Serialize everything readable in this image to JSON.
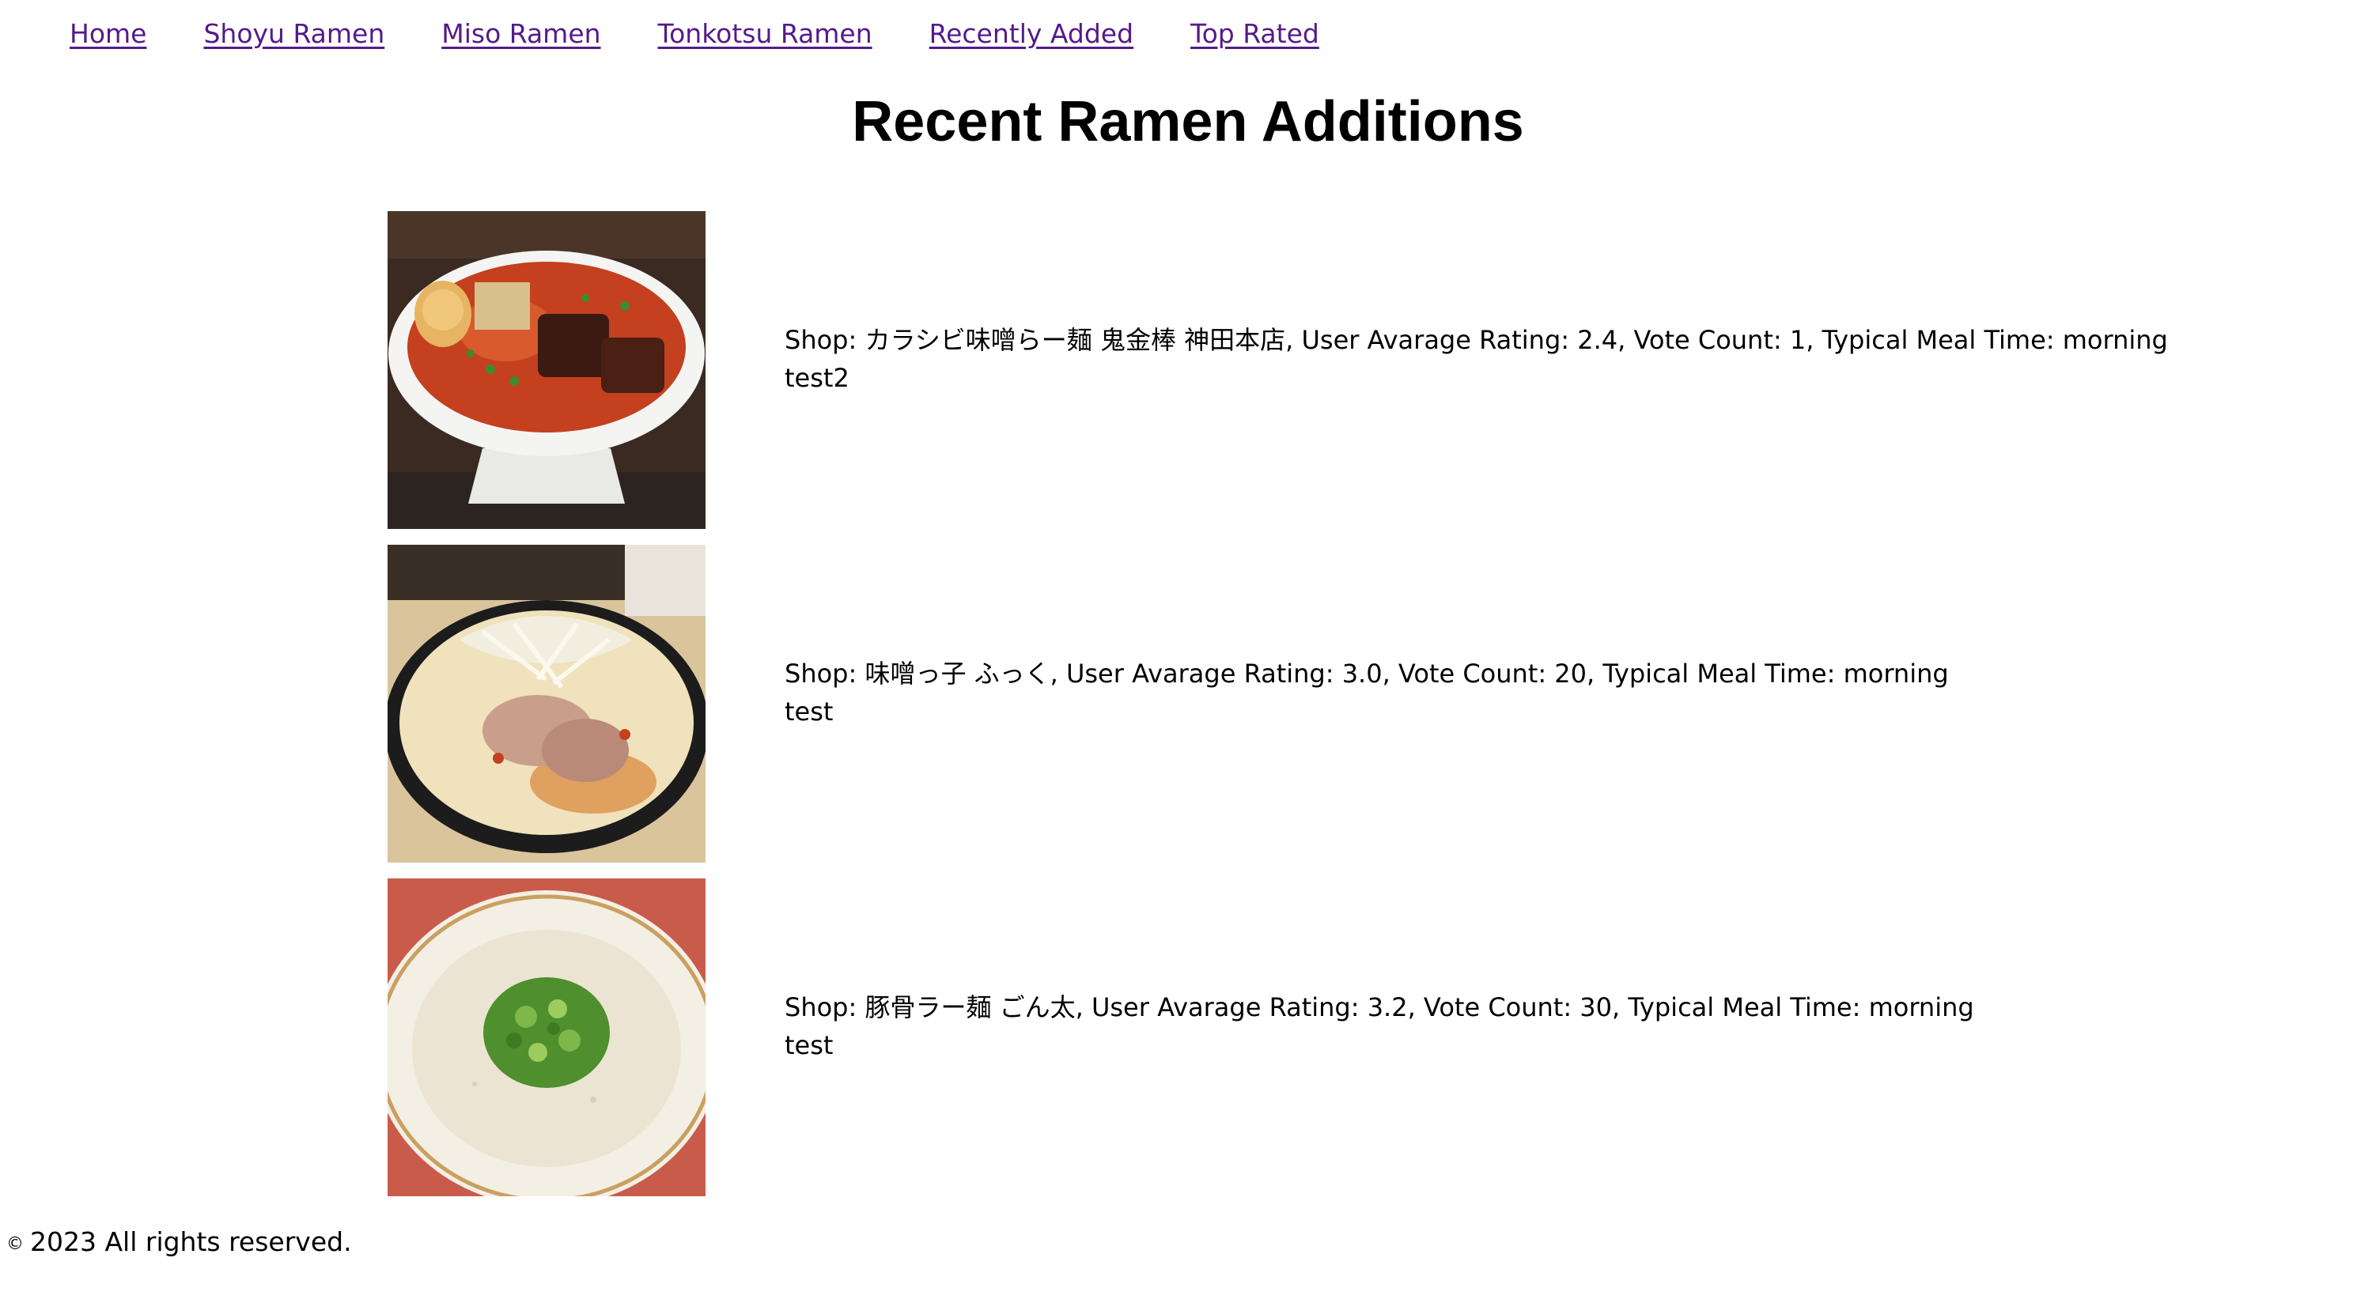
{
  "nav": {
    "links": [
      {
        "label": "Home"
      },
      {
        "label": "Shoyu Ramen"
      },
      {
        "label": "Miso Ramen"
      },
      {
        "label": "Tonkotsu Ramen"
      },
      {
        "label": "Recently Added"
      },
      {
        "label": "Top Rated"
      }
    ],
    "link_color": "#551a8b"
  },
  "page_title": "Recent Ramen Additions",
  "ramen_items": [
    {
      "summary": "Shop: カラシビ味噌らー麺 鬼金棒 神田本店, User Avarage Rating: 2.4, Vote Count: 1, Typical Meal Time: morning",
      "comment": "test2"
    },
    {
      "summary": "Shop: 味噌っ子 ふっく, User Avarage Rating: 3.0, Vote Count: 20, Typical Meal Time: morning",
      "comment": "test"
    },
    {
      "summary": "Shop: 豚骨ラー麺 ごん太, User Avarage Rating: 3.2, Vote Count: 30, Typical Meal Time: morning",
      "comment": "test"
    }
  ],
  "footer": {
    "copyright_symbol": "©",
    "text": "2023 All rights reserved."
  }
}
